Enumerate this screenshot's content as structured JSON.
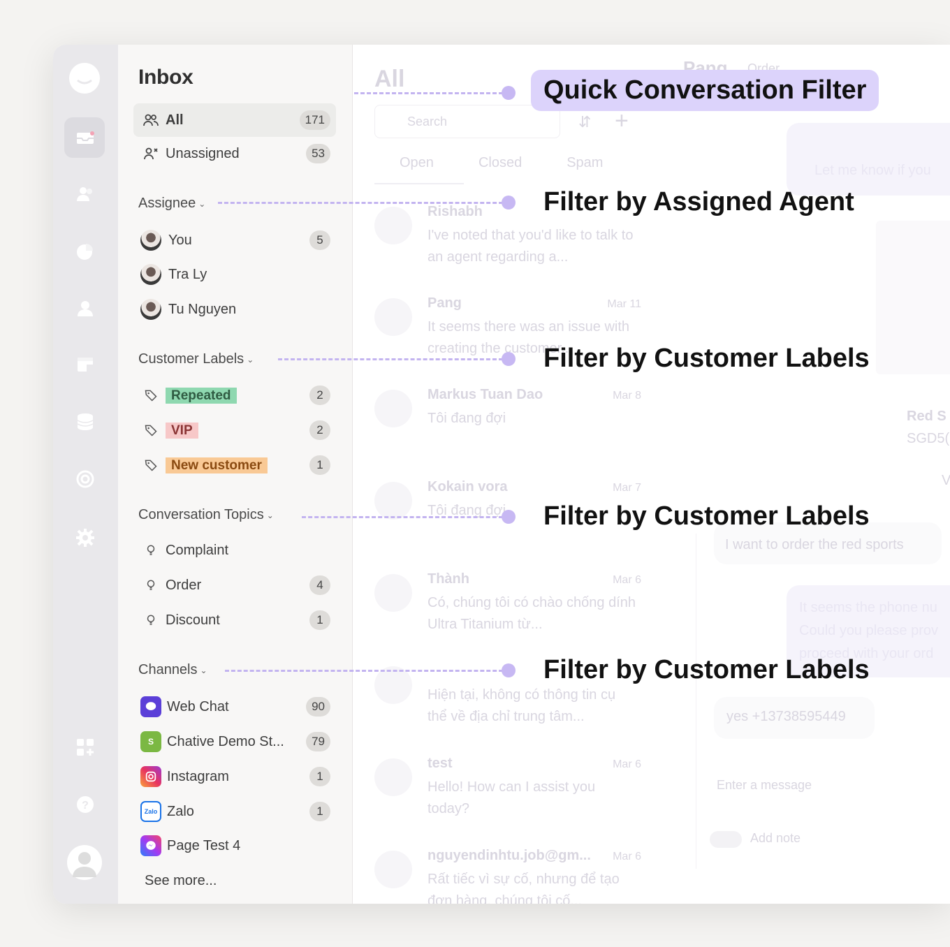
{
  "sidebar": {
    "title": "Inbox",
    "quick": [
      {
        "label": "All",
        "count": "171"
      },
      {
        "label": "Unassigned",
        "count": "53"
      }
    ],
    "assignee": {
      "heading": "Assignee",
      "items": [
        {
          "label": "You",
          "count": "5"
        },
        {
          "label": "Tra Ly",
          "count": ""
        },
        {
          "label": "Tu Nguyen",
          "count": ""
        }
      ]
    },
    "labels": {
      "heading": "Customer Labels",
      "items": [
        {
          "label": "Repeated",
          "count": "2",
          "bg": "#8fd8b0",
          "fg": "#2f5b42"
        },
        {
          "label": "VIP",
          "count": "2",
          "bg": "#f7c8c8",
          "fg": "#8a3434"
        },
        {
          "label": "New customer",
          "count": "1",
          "bg": "#f9c995",
          "fg": "#8a4a11"
        }
      ]
    },
    "topics": {
      "heading": "Conversation Topics",
      "items": [
        {
          "label": "Complaint",
          "count": ""
        },
        {
          "label": "Order",
          "count": "4"
        },
        {
          "label": "Discount",
          "count": "1"
        }
      ]
    },
    "channels": {
      "heading": "Channels",
      "items": [
        {
          "label": "Web Chat",
          "count": "90",
          "icon": "webchat-icon",
          "color": "#5b3fd8"
        },
        {
          "label": "Chative Demo St...",
          "count": "79",
          "icon": "shopify-icon",
          "color": "#7bb843"
        },
        {
          "label": "Instagram",
          "count": "1",
          "icon": "instagram-icon",
          "color": "#e84a6a"
        },
        {
          "label": "Zalo",
          "count": "1",
          "icon": "zalo-icon",
          "color": "#1a73e8"
        },
        {
          "label": "Page Test 4",
          "count": "",
          "icon": "messenger-icon",
          "color": "#8a4df0"
        }
      ],
      "see_more": "See more..."
    }
  },
  "main": {
    "title": "All",
    "search_placeholder": "Search",
    "tabs": [
      "Open",
      "Closed",
      "Spam"
    ],
    "conversations": [
      {
        "name": "Rishabh",
        "date": "",
        "msg": "I've noted that you'd like to talk to an agent regarding a..."
      },
      {
        "name": "Pang",
        "date": "Mar 11",
        "msg": "It seems there was an issue with creating the customer..."
      },
      {
        "name": "Markus Tuan Dao",
        "date": "Mar 8",
        "msg": "Tôi đang đợi"
      },
      {
        "name": "Kokain vora",
        "date": "Mar 7",
        "msg": "Tôi đang đợi"
      },
      {
        "name": "Thành",
        "date": "Mar 6",
        "msg": "Có, chúng tôi có chào chống dính Ultra Titanium từ..."
      },
      {
        "name": "",
        "date": "",
        "msg": "Hiện tại, không có thông tin cụ thể về địa chỉ trung tâm..."
      },
      {
        "name": "test",
        "date": "Mar 6",
        "msg": "Hello! How can I assist you today?"
      },
      {
        "name": "nguyendinhtu.job@gm...",
        "date": "Mar 6",
        "msg": "Rất tiếc vì sự cố, nhưng để tạo đơn hàng, chúng tôi cố..."
      }
    ],
    "chat": {
      "contact": "Pang",
      "contact_sub": "Order",
      "bubble1": "Let me know if you",
      "product_name": "Red S",
      "product_price": "SGD5(",
      "product_v": "V",
      "customer_msg1": "I want to order the red sports",
      "bubble2": "It seems the phone nu Could you please prov proceed with your ord",
      "customer_msg2": "yes +13738595449",
      "composer_placeholder": "Enter a message",
      "add_note": "Add note"
    }
  },
  "annotations": [
    {
      "text": "Quick Conversation Filter"
    },
    {
      "text": "Filter by Assigned Agent"
    },
    {
      "text": "Filter by Customer Labels"
    },
    {
      "text": "Filter by Customer Labels"
    },
    {
      "text": "Filter by Customer Labels"
    }
  ]
}
